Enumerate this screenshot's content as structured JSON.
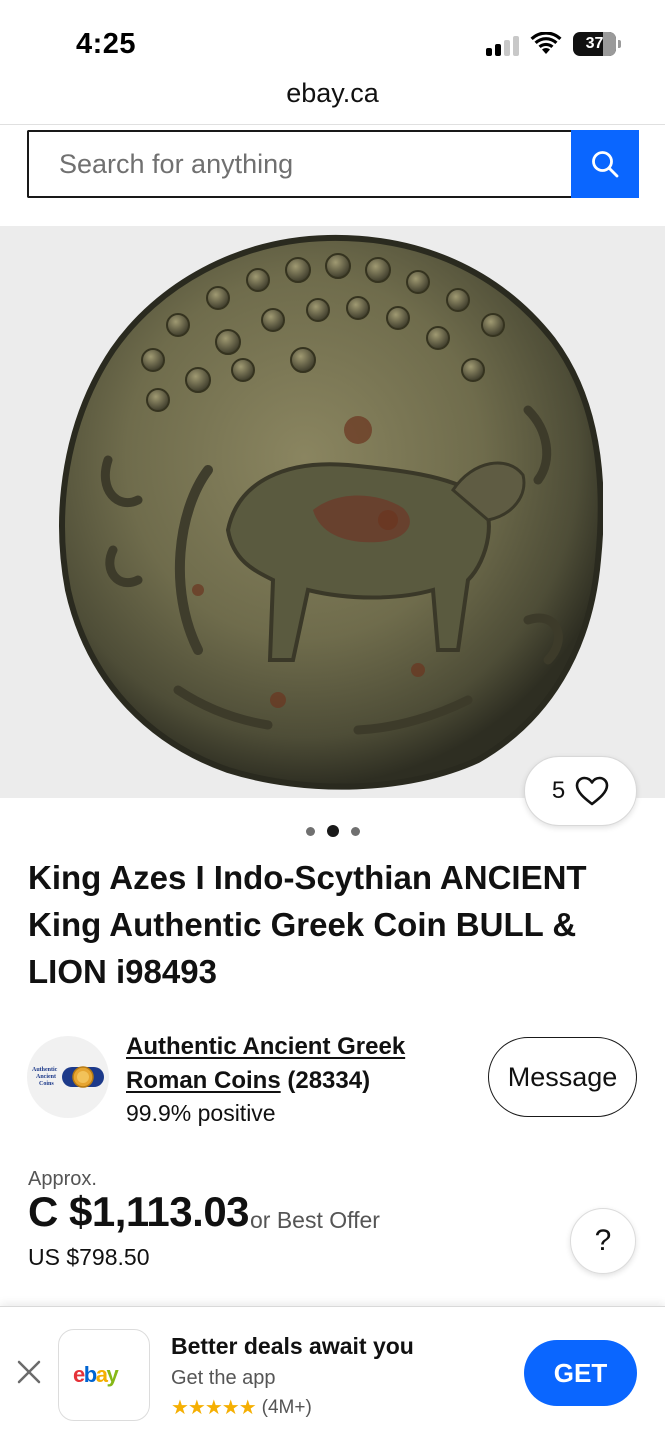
{
  "status_bar": {
    "time": "4:25",
    "battery": "37"
  },
  "browser": {
    "url": "ebay.ca"
  },
  "search": {
    "placeholder": "Search for anything",
    "icon": "search-icon"
  },
  "gallery": {
    "watch_count": "5",
    "total_images": 3,
    "active_index": 1
  },
  "listing": {
    "title": "King Azes I Indo-Scythian ANCIENT King Authentic Greek Coin BULL & LION i98493"
  },
  "seller": {
    "avatar_text": "Authentic Ancient Coins",
    "name": "Authentic Ancient Greek Roman Coins",
    "count": "(28334)",
    "feedback": "99.9% positive",
    "message_label": "Message"
  },
  "price": {
    "approx_label": "Approx.",
    "amount": "C $1,113.03",
    "best_offer": "or Best Offer",
    "us_price": "US $798.50",
    "help_label": "?"
  },
  "app_banner": {
    "title": "Better deals await you",
    "subtitle": "Get the app",
    "stars": "★★★★★",
    "rating_count": "(4M+)",
    "get_label": "GET",
    "logo": "ebay"
  },
  "colors": {
    "brand_blue": "#0a66ff",
    "star_yellow": "#f5af02",
    "logo_red": "#e53238",
    "logo_blue": "#0064d2",
    "logo_yellow": "#f5af02",
    "logo_green": "#86b817"
  }
}
